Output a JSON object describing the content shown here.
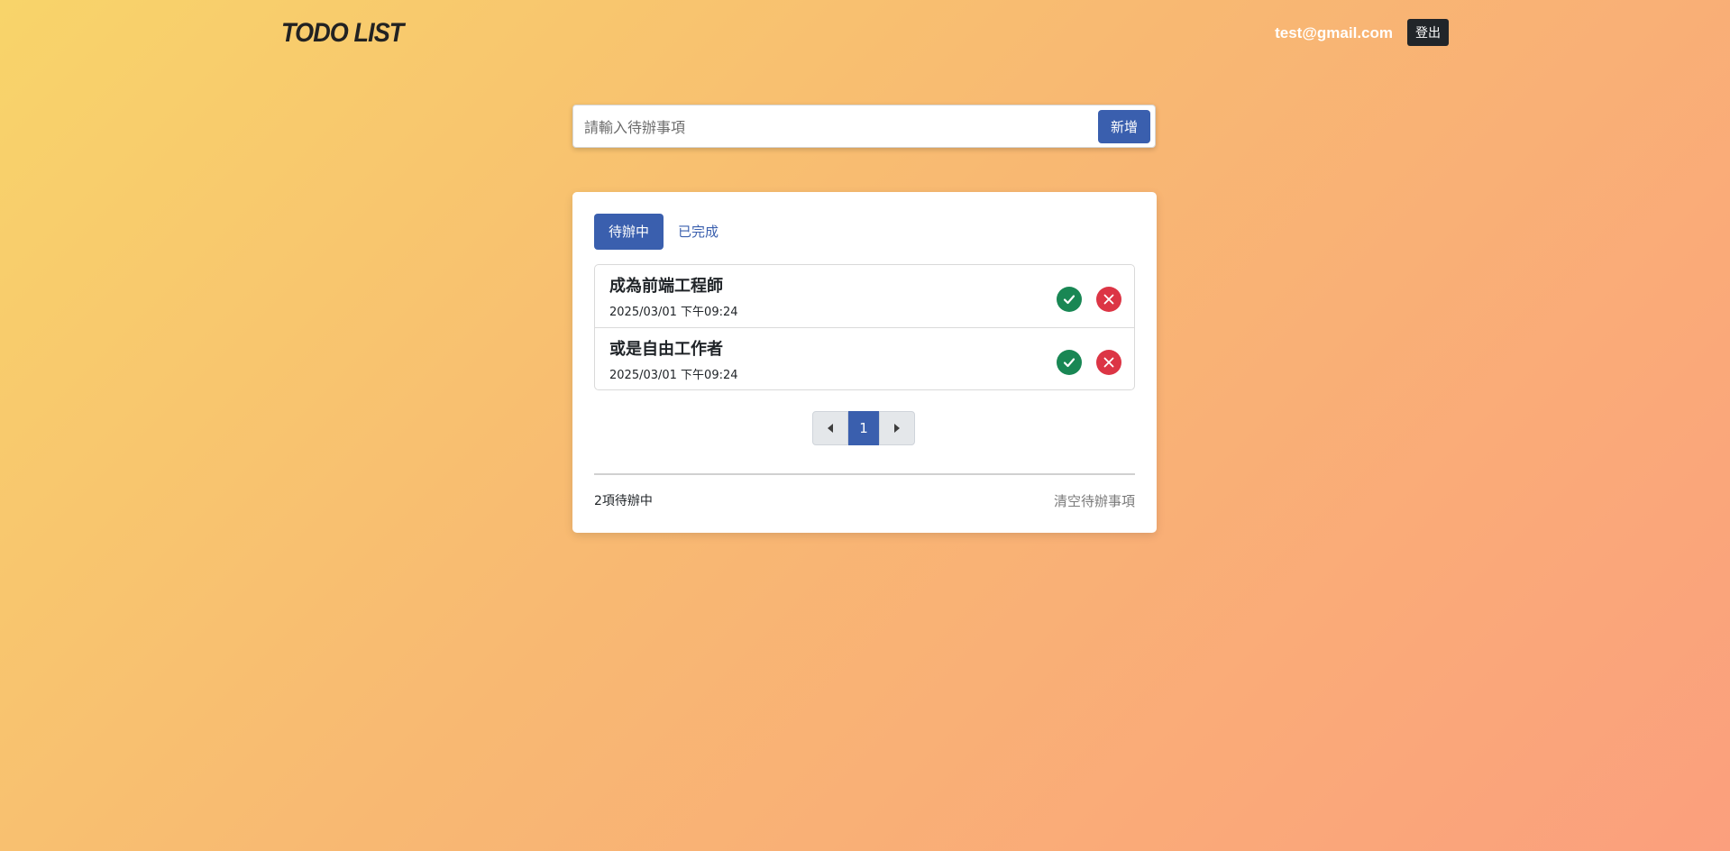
{
  "header": {
    "logo": "TODO LIST",
    "user_email": "test@gmail.com",
    "logout_label": "登出"
  },
  "add_form": {
    "placeholder": "請輸入待辦事項",
    "value": "",
    "submit_label": "新增"
  },
  "tabs": [
    {
      "label": "待辦中",
      "active": true
    },
    {
      "label": "已完成",
      "active": false
    }
  ],
  "todos": [
    {
      "title": "成為前端工程師",
      "date": "2025/03/01 下午09:24"
    },
    {
      "title": "或是自由工作者",
      "date": "2025/03/01 下午09:24"
    }
  ],
  "pagination": {
    "current_page": "1",
    "prev_icon": "caret-left-icon",
    "next_icon": "caret-right-icon"
  },
  "footer": {
    "count_text": "2項待辦中",
    "clear_label": "清空待辦事項"
  },
  "icons": {
    "done": "check-icon",
    "delete": "x-icon"
  },
  "colors": {
    "primary": "#3a5fae",
    "success": "#198754",
    "danger": "#dc3545",
    "dark": "#212529"
  }
}
